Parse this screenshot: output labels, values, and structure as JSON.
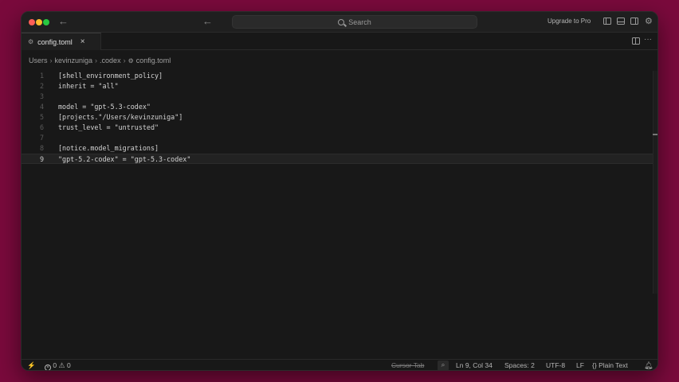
{
  "titlebar": {
    "search_placeholder": "Search",
    "upgrade_label": "Upgrade to Pro"
  },
  "tab": {
    "label": "config.toml",
    "close": "×"
  },
  "breadcrumb": [
    "Users",
    "kevinzuniga",
    ".codex",
    "config.toml"
  ],
  "editor": {
    "current_line": 9,
    "lines": [
      {
        "n": "1",
        "text": "[shell_environment_policy]"
      },
      {
        "n": "2",
        "text": "inherit = \"all\""
      },
      {
        "n": "3",
        "text": ""
      },
      {
        "n": "4",
        "text": "model = \"gpt-5.3-codex\""
      },
      {
        "n": "5",
        "text": "[projects.\"/Users/kevinzuniga\"]"
      },
      {
        "n": "6",
        "text": "trust_level = \"untrusted\""
      },
      {
        "n": "7",
        "text": ""
      },
      {
        "n": "8",
        "text": "[notice.model_migrations]"
      },
      {
        "n": "9",
        "text": "\"gpt-5.2-codex\" = \"gpt-5.3-codex\""
      }
    ]
  },
  "statusbar": {
    "errors": "0",
    "warnings": "0",
    "cursor_tab": "Cursor Tab",
    "position": "Ln 9, Col 34",
    "spaces": "Spaces: 2",
    "encoding": "UTF-8",
    "eol": "LF",
    "language": "Plain Text"
  }
}
